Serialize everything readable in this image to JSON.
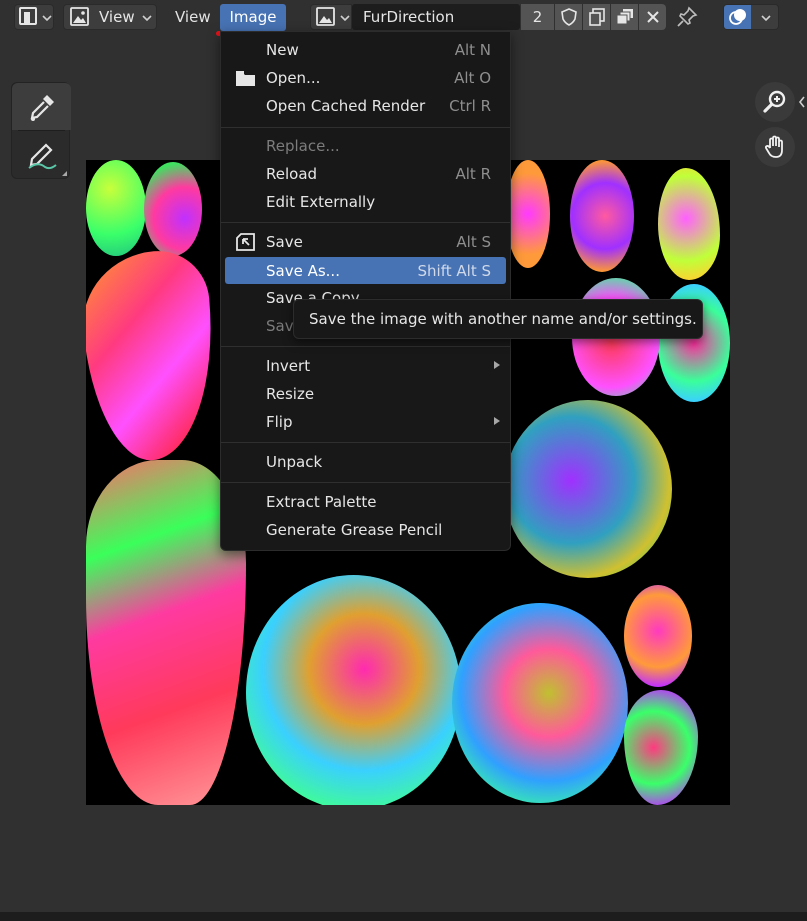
{
  "header": {
    "view_menu_label": "View",
    "view_label": "View",
    "image_menu_label": "Image",
    "image_name": "FurDirection",
    "user_count": "2"
  },
  "toolbar": {
    "tools": [
      "eyedropper-icon",
      "annotate-icon"
    ]
  },
  "image_menu": {
    "items": [
      {
        "label": "New",
        "shortcut": "Alt N"
      },
      {
        "label": "Open...",
        "shortcut": "Alt O"
      },
      {
        "label": "Open Cached Render",
        "shortcut": "Ctrl R"
      },
      {
        "label": "Replace...",
        "shortcut": ""
      },
      {
        "label": "Reload",
        "shortcut": "Alt R"
      },
      {
        "label": "Edit Externally",
        "shortcut": ""
      },
      {
        "label": "Save",
        "shortcut": "Alt S"
      },
      {
        "label": "Save As...",
        "shortcut": "Shift Alt S"
      },
      {
        "label": "Save a Copy",
        "shortcut": ""
      },
      {
        "label": "Save All Images",
        "shortcut": ""
      },
      {
        "label": "Invert",
        "shortcut": ""
      },
      {
        "label": "Resize",
        "shortcut": ""
      },
      {
        "label": "Flip",
        "shortcut": ""
      },
      {
        "label": "Unpack",
        "shortcut": ""
      },
      {
        "label": "Extract Palette",
        "shortcut": ""
      },
      {
        "label": "Generate Grease Pencil",
        "shortcut": ""
      }
    ]
  },
  "tooltip": {
    "text": "Save the image with another name and/or settings."
  },
  "colors": {
    "accent": "#4772b3",
    "annotation_red": "#e8121a",
    "menu_bg": "#181818",
    "editor_bg": "#303030"
  }
}
